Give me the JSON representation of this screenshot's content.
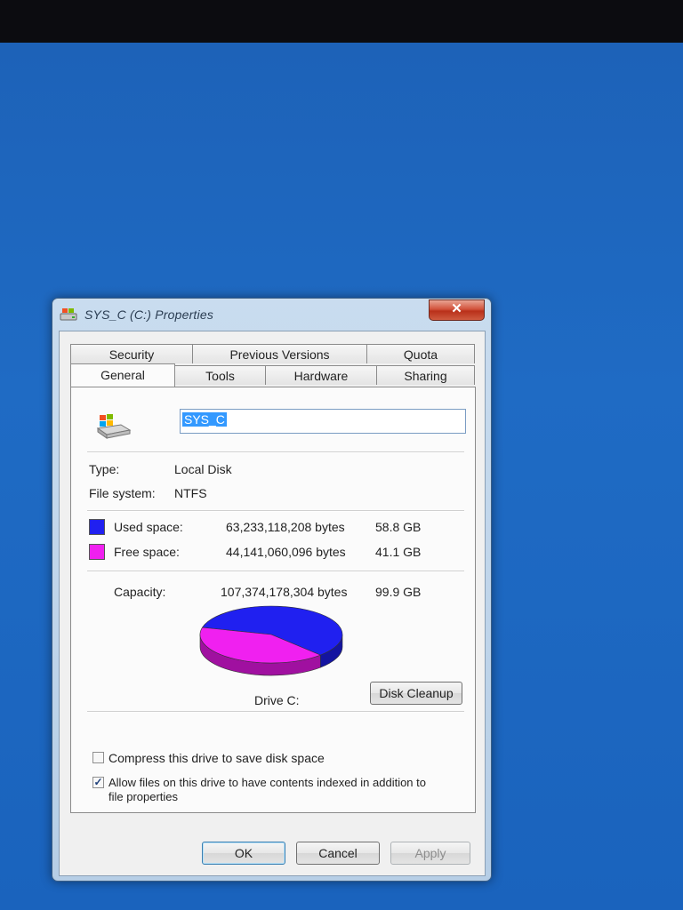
{
  "window": {
    "title": "SYS_C (C:) Properties",
    "close_glyph": "✕"
  },
  "tabs": {
    "row_back": [
      "Security",
      "Previous Versions",
      "Quota"
    ],
    "row_front": [
      "General",
      "Tools",
      "Hardware",
      "Sharing"
    ],
    "active": "General"
  },
  "general": {
    "volume_name": "SYS_C",
    "type_label": "Type:",
    "type_value": "Local Disk",
    "fs_label": "File system:",
    "fs_value": "NTFS",
    "used_label": "Used space:",
    "used_bytes": "63,233,118,208 bytes",
    "used_gb": "58.8 GB",
    "free_label": "Free space:",
    "free_bytes": "44,141,060,096 bytes",
    "free_gb": "41.1 GB",
    "capacity_label": "Capacity:",
    "capacity_bytes": "107,374,178,304 bytes",
    "capacity_gb": "99.9 GB",
    "drive_label": "Drive C:",
    "disk_cleanup": "Disk Cleanup",
    "compress_label": "Compress this drive to save disk space",
    "compress_checked": false,
    "index_label_line1": "Allow files on this drive to have contents indexed in addition to",
    "index_label_line2": "file properties",
    "index_checked": true,
    "check_glyph": "✓"
  },
  "chart_data": {
    "type": "pie",
    "categories": [
      "Used space",
      "Free space"
    ],
    "values": [
      58.8,
      41.1
    ],
    "colors": [
      "#2020f0",
      "#f020f0"
    ],
    "title": "Drive C:"
  },
  "colors": {
    "used": "#2020f0",
    "free": "#f020f0",
    "used_dark": "#1414a0",
    "free_dark": "#a010a0"
  },
  "buttons": {
    "ok": "OK",
    "cancel": "Cancel",
    "apply": "Apply"
  }
}
